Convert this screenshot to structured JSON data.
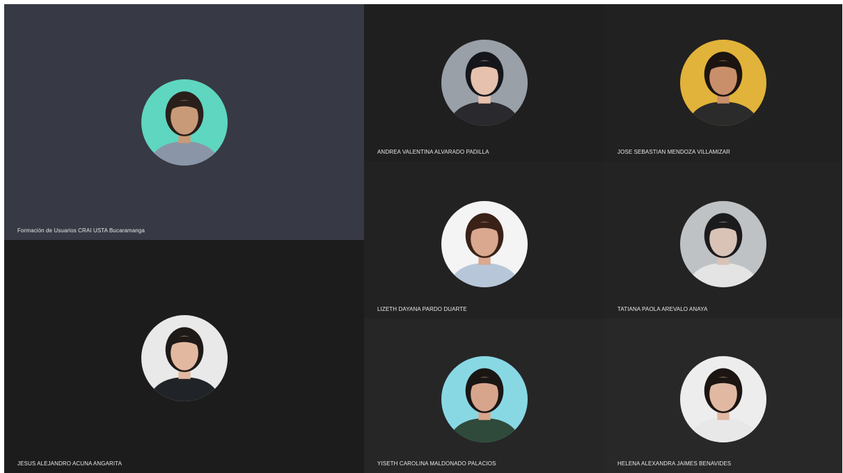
{
  "meeting": {
    "participants": [
      {
        "name": "Formación de Usuarios CRAI USTA Bucaramanga",
        "bg": "#5fd6c0",
        "skin": "#c99a78",
        "hair": "#2a1f1a",
        "shirt": "#8b95a8"
      },
      {
        "name": "JESUS ALEJANDRO ACUNA ANGARITA",
        "bg": "#e9e9e9",
        "skin": "#e2b9a0",
        "hair": "#1e1a18",
        "shirt": "#202428"
      },
      {
        "name": "ANDREA VALENTINA ALVARADO PADILLA",
        "bg": "#9aa0a8",
        "skin": "#e6c1ae",
        "hair": "#15161b",
        "shirt": "#2a2a2e"
      },
      {
        "name": "JOSE SEBASTIAN MENDOZA VILLAMIZAR",
        "bg": "#e2b33a",
        "skin": "#c98f6a",
        "hair": "#1c1410",
        "shirt": "#2b2b2b"
      },
      {
        "name": "LIZETH DAYANA PARDO DUARTE",
        "bg": "#f4f4f4",
        "skin": "#d9a88e",
        "hair": "#3a2118",
        "shirt": "#b7c7d9"
      },
      {
        "name": "TATIANA PAOLA AREVALO ANAYA",
        "bg": "#bfc2c4",
        "skin": "#d9c2b6",
        "hair": "#1b1b1d",
        "shirt": "#e4e4e4"
      },
      {
        "name": "YISETH CAROLINA MALDONADO PALACIOS",
        "bg": "#88d8e4",
        "skin": "#d7a58c",
        "hair": "#1a1614",
        "shirt": "#2f4a3a"
      },
      {
        "name": "HELENA ALEXANDRA JAIMES BENAVIDES",
        "bg": "#ededed",
        "skin": "#e1b8a2",
        "hair": "#1c1512",
        "shirt": "#e8e8e8"
      }
    ]
  }
}
